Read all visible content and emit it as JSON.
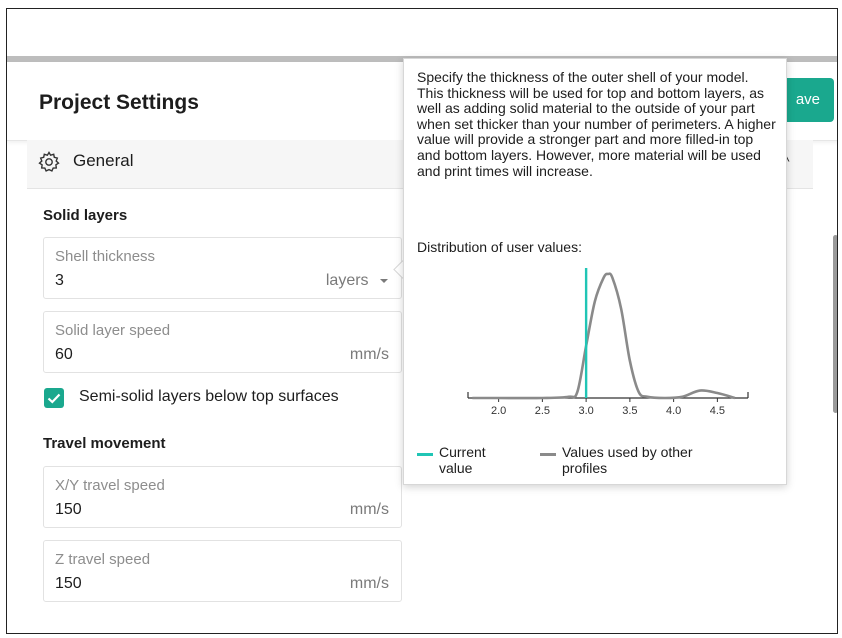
{
  "header": {
    "title": "Project Settings",
    "save_label": "ave"
  },
  "section": {
    "label": "General",
    "icon": "gear-icon"
  },
  "solid_layers": {
    "heading": "Solid layers",
    "shell_thickness": {
      "label": "Shell thickness",
      "value": "3",
      "unit": "layers"
    },
    "solid_layer_speed": {
      "label": "Solid layer speed",
      "value": "60",
      "unit": "mm/s"
    },
    "semi_solid": {
      "label": "Semi-solid layers below top surfaces",
      "checked": true
    }
  },
  "travel": {
    "heading": "Travel movement",
    "xy_speed": {
      "label": "X/Y travel speed",
      "value": "150",
      "unit": "mm/s"
    },
    "z_speed": {
      "label": "Z travel speed",
      "value": "150",
      "unit": "mm/s"
    }
  },
  "tooltip": {
    "description": "Specify the thickness of the outer shell of your model. This thickness will be used for top and bottom layers, as well as adding solid material to the outside of your part when set thicker than your number of perimeters. A higher value will provide a stronger part and more filled-in top and bottom layers. However, more material will be used and print times will increase.",
    "dist_label": "Distribution of user values:",
    "legend": {
      "current": "Current value",
      "others": "Values used by other profiles"
    }
  },
  "colors": {
    "accent": "#1aa88e",
    "current_line": "#20c5b5",
    "distribution": "#8a8a8a"
  },
  "chart_data": {
    "type": "line",
    "x_ticks": [
      "2.0",
      "2.5",
      "3.0",
      "3.5",
      "4.0",
      "4.5"
    ],
    "xlim": [
      1.65,
      4.85
    ],
    "current_value": 3.0,
    "series": [
      {
        "name": "Values used by other profiles",
        "x": [
          1.7,
          2.0,
          2.5,
          2.8,
          2.9,
          3.0,
          3.1,
          3.2,
          3.25,
          3.3,
          3.4,
          3.5,
          3.6,
          3.7,
          3.9,
          4.1,
          4.3,
          4.5,
          4.7
        ],
        "y": [
          0,
          0,
          0,
          0.01,
          0.05,
          0.42,
          0.78,
          0.97,
          1.0,
          0.97,
          0.72,
          0.3,
          0.05,
          0.01,
          0,
          0.01,
          0.06,
          0.04,
          0
        ]
      }
    ],
    "legend": [
      "Current value",
      "Values used by other profiles"
    ]
  }
}
